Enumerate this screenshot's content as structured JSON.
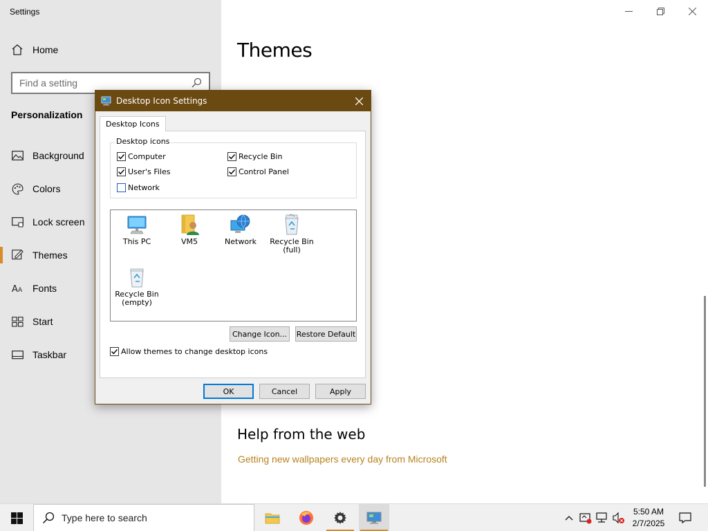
{
  "settings": {
    "app_title": "Settings",
    "home_label": "Home",
    "search_placeholder": "Find a setting",
    "section_title": "Personalization",
    "nav_items": [
      {
        "label": "Background",
        "icon": "picture-icon"
      },
      {
        "label": "Colors",
        "icon": "palette-icon"
      },
      {
        "label": "Lock screen",
        "icon": "lock-screen-icon"
      },
      {
        "label": "Themes",
        "icon": "brush-icon",
        "active": true
      },
      {
        "label": "Fonts",
        "icon": "fonts-icon"
      },
      {
        "label": "Start",
        "icon": "start-tiles-icon"
      },
      {
        "label": "Taskbar",
        "icon": "taskbar-icon"
      }
    ],
    "accent_color": "#d78b2b"
  },
  "main": {
    "title": "Themes",
    "help_title": "Help from the web",
    "help_link": "Getting new wallpapers every day from Microsoft"
  },
  "dialog": {
    "title": "Desktop Icon Settings",
    "tab_label": "Desktop Icons",
    "group_label": "Desktop icons",
    "checkboxes": [
      {
        "label": "Computer",
        "checked": true
      },
      {
        "label": "Recycle Bin",
        "checked": true
      },
      {
        "label": "User's Files",
        "checked": true
      },
      {
        "label": "Control Panel",
        "checked": true
      },
      {
        "label": "Network",
        "checked": false
      }
    ],
    "icons": [
      {
        "label": "This PC",
        "icon": "computer-icon"
      },
      {
        "label": "VM5",
        "icon": "user-folder-icon"
      },
      {
        "label": "Network",
        "icon": "network-globe-icon"
      },
      {
        "label": "Recycle Bin\n(full)",
        "line1": "Recycle Bin",
        "line2": "(full)",
        "icon": "recycle-bin-full-icon"
      },
      {
        "label": "Recycle Bin\n(empty)",
        "line1": "Recycle Bin",
        "line2": "(empty)",
        "icon": "recycle-bin-empty-icon"
      }
    ],
    "change_icon_label": "Change Icon...",
    "restore_default_label": "Restore Default",
    "allow_themes_label": "Allow themes to change desktop icons",
    "allow_themes_checked": true,
    "ok_label": "OK",
    "cancel_label": "Cancel",
    "apply_label": "Apply",
    "titlebar_color": "#6b4a12"
  },
  "taskbar": {
    "search_placeholder": "Type here to search",
    "apps": [
      "file-explorer-icon",
      "firefox-icon",
      "settings-gear-icon",
      "desktop-icon-settings-icon"
    ],
    "time": "5:50 AM",
    "date": "2/7/2025"
  }
}
